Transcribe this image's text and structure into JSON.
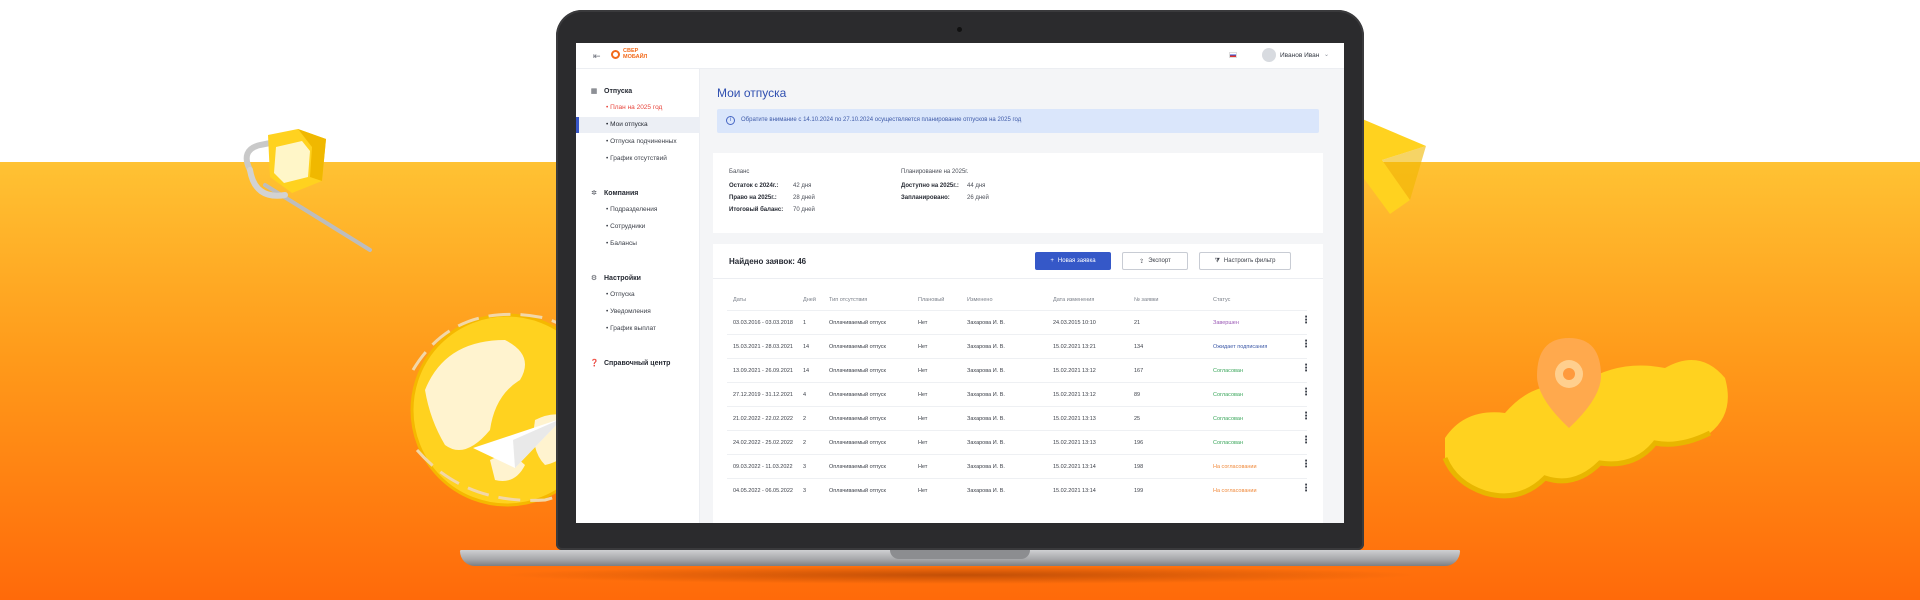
{
  "colors": {
    "accent": "#3558c8",
    "orange": "#ff6a0a",
    "yellow": "#ffc233",
    "status_purple": "#9b59b6",
    "status_blue": "#3e5aa8",
    "status_green": "#3aa65b",
    "status_orange": "#f08a3c"
  },
  "header": {
    "logo_text": "СВЕР МОБАЙЛ",
    "user_name": "Иванов Иван"
  },
  "sidebar": {
    "sections": [
      {
        "title": "Отпуска",
        "icon": "suitcase-icon",
        "items": [
          "План на 2025 год",
          "Мои отпуска",
          "Отпуска подчиненных",
          "График отсутствий"
        ]
      },
      {
        "title": "Компания",
        "icon": "company-icon",
        "items": [
          "Подразделения",
          "Сотрудники",
          "Балансы"
        ]
      },
      {
        "title": "Настройки",
        "icon": "gear-icon",
        "items": [
          "Отпуска",
          "Уведомления",
          "График выплат"
        ]
      },
      {
        "title": "Справочный центр",
        "icon": "help-icon",
        "items": []
      }
    ]
  },
  "main": {
    "title": "Мои отпуска",
    "notice": "Обратите внимание с 14.10.2024 по 27.10.2024 осуществляется планирование отпусков на 2025 год",
    "balance": {
      "left_title": "Баланс",
      "left": [
        {
          "label": "Остаток с 2024г.:",
          "value": "42 дня"
        },
        {
          "label": "Право на 2025г.:",
          "value": "28 дней"
        },
        {
          "label": "Итоговый баланс:",
          "value": "70 дней"
        }
      ],
      "right_title": "Планирование на 2025г.",
      "right": [
        {
          "label": "Доступно на 2025г.:",
          "value": "44 дня"
        },
        {
          "label": "Запланировано:",
          "value": "26 дней"
        }
      ]
    },
    "found_label": "Найдено заявок: 46",
    "buttons": {
      "new": "Новая заявка",
      "export": "Экспорт",
      "filter": "Настроить фильтр"
    },
    "table": {
      "columns": [
        "Даты",
        "Дней",
        "Тип отсутствия",
        "Плановый",
        "Изменено",
        "Дата изменения",
        "№ заявки",
        "Статус"
      ],
      "rows": [
        {
          "dates": "03.03.2016 - 03.03.2018",
          "days": "1",
          "type": "Оплачиваемый отпуск",
          "planned": "Нет",
          "changed": "Захарова И. В.",
          "date_changed": "24.03.2015 10:10",
          "num": "21",
          "status": "Завершен",
          "status_color": "#9b59b6"
        },
        {
          "dates": "15.03.2021 - 28.03.2021",
          "days": "14",
          "type": "Оплачиваемый отпуск",
          "planned": "Нет",
          "changed": "Захарова И. В.",
          "date_changed": "15.02.2021 13:21",
          "num": "134",
          "status": "Ожидает подписания",
          "status_color": "#3e5aa8"
        },
        {
          "dates": "13.09.2021 - 26.09.2021",
          "days": "14",
          "type": "Оплачиваемый отпуск",
          "planned": "Нет",
          "changed": "Захарова И. В.",
          "date_changed": "15.02.2021 13:12",
          "num": "167",
          "status": "Согласован",
          "status_color": "#3aa65b"
        },
        {
          "dates": "27.12.2019 - 31.12.2021",
          "days": "4",
          "type": "Оплачиваемый отпуск",
          "planned": "Нет",
          "changed": "Захарова И. В.",
          "date_changed": "15.02.2021 13:12",
          "num": "89",
          "status": "Согласован",
          "status_color": "#3aa65b"
        },
        {
          "dates": "21.02.2022 - 22.02.2022",
          "days": "2",
          "type": "Оплачиваемый отпуск",
          "planned": "Нет",
          "changed": "Захарова И. В.",
          "date_changed": "15.02.2021 13:13",
          "num": "25",
          "status": "Согласован",
          "status_color": "#3aa65b"
        },
        {
          "dates": "24.02.2022 - 25.02.2022",
          "days": "2",
          "type": "Оплачиваемый отпуск",
          "planned": "Нет",
          "changed": "Захарова И. В.",
          "date_changed": "15.02.2021 13:13",
          "num": "196",
          "status": "Согласован",
          "status_color": "#3aa65b"
        },
        {
          "dates": "09.03.2022 - 11.03.2022",
          "days": "3",
          "type": "Оплачиваемый отпуск",
          "planned": "Нет",
          "changed": "Захарова И. В.",
          "date_changed": "15.02.2021 13:14",
          "num": "198",
          "status": "На согласовании",
          "status_color": "#f08a3c"
        },
        {
          "dates": "04.05.2022 - 06.05.2022",
          "days": "3",
          "type": "Оплачиваемый отпуск",
          "planned": "Нет",
          "changed": "Захарова И. В.",
          "date_changed": "15.02.2021 13:14",
          "num": "199",
          "status": "На согласовании",
          "status_color": "#f08a3c"
        }
      ]
    }
  }
}
